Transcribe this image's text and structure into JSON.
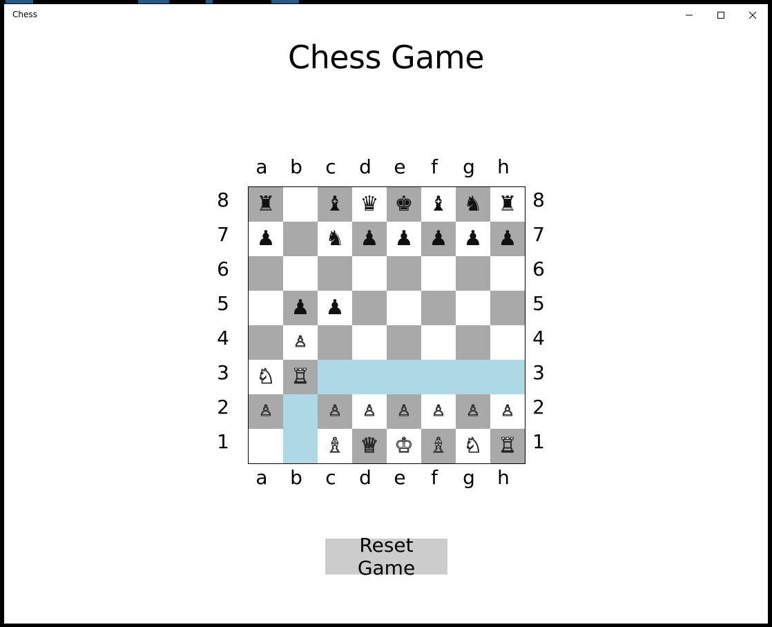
{
  "window": {
    "title": "Chess",
    "controls": {
      "minimize": "minimize",
      "maximize": "maximize",
      "close": "close"
    }
  },
  "page": {
    "title": "Chess Game",
    "reset_label": "Reset Game"
  },
  "board": {
    "files": [
      "a",
      "b",
      "c",
      "d",
      "e",
      "f",
      "g",
      "h"
    ],
    "ranks": [
      "8",
      "7",
      "6",
      "5",
      "4",
      "3",
      "2",
      "1"
    ],
    "colors": {
      "light": "#ffffff",
      "dark": "#a9a9a9",
      "highlight": "#add8e6"
    },
    "highlighted_squares": [
      "c3",
      "d3",
      "e3",
      "f3",
      "g3",
      "h3",
      "b2",
      "b1"
    ],
    "rows": [
      [
        "br",
        "",
        "bb",
        "bq",
        "bk",
        "bb",
        "bn",
        "br"
      ],
      [
        "bp",
        "",
        "bn",
        "bp",
        "bp",
        "bp",
        "bp",
        "bp"
      ],
      [
        "",
        "",
        "",
        "",
        "",
        "",
        "",
        ""
      ],
      [
        "",
        "bp",
        "bp",
        "",
        "",
        "",
        "",
        ""
      ],
      [
        "",
        "wp",
        "",
        "",
        "",
        "",
        "",
        ""
      ],
      [
        "wn",
        "wr",
        "",
        "",
        "",
        "",
        "",
        ""
      ],
      [
        "wp",
        "",
        "wp",
        "wp",
        "wp",
        "wp",
        "wp",
        "wp"
      ],
      [
        "",
        "",
        "wb",
        "wq",
        "wk",
        "wb",
        "wn",
        "wr"
      ]
    ],
    "piece_names": {
      "k": "king",
      "q": "queen",
      "r": "rook",
      "b": "bishop",
      "n": "knight",
      "p": "pawn"
    }
  }
}
